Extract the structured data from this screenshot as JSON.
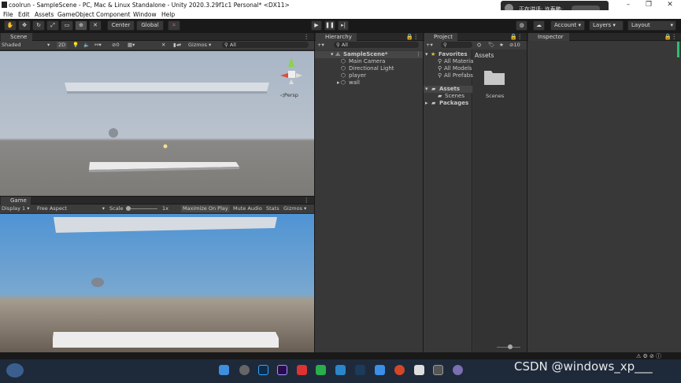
{
  "window": {
    "title": "coolrun - SampleScene - PC, Mac & Linux Standalone - Unity 2020.3.29f1c1 Personal* <DX11>"
  },
  "notification": {
    "text": "正在讲话: 许寿鹏;"
  },
  "menu": [
    "File",
    "Edit",
    "Assets",
    "GameObject",
    "Component",
    "Window",
    "Help"
  ],
  "toolbar": {
    "center": "Center",
    "global": "Global",
    "account": "Account",
    "layers": "Layers",
    "layout": "Layout"
  },
  "scene": {
    "tab": "Scene",
    "shading": "Shaded",
    "mode2d": "2D",
    "hidden_count": "0",
    "gizmos": "Gizmos",
    "search_placeholder": "All",
    "persp": "Persp"
  },
  "game": {
    "tab": "Game",
    "display": "Display 1",
    "aspect": "Free Aspect",
    "scale_label": "Scale",
    "scale_value": "1x",
    "maximize": "Maximize On Play",
    "mute": "Mute Audio",
    "stats": "Stats",
    "gizmos": "Gizmos"
  },
  "hierarchy": {
    "tab": "Hierarchy",
    "search_placeholder": "All",
    "scene": "SampleScene*",
    "items": [
      "Main Camera",
      "Directional Light",
      "player",
      "wall"
    ]
  },
  "project": {
    "tab": "Project",
    "favorites": "Favorites",
    "fav_items": [
      "All Materials",
      "All Models",
      "All Prefabs"
    ],
    "assets": "Assets",
    "asset_children": [
      "Scenes"
    ],
    "packages": "Packages",
    "breadcrumb": "Assets",
    "folder": "Scenes",
    "count": "10"
  },
  "inspector": {
    "tab": "Inspector"
  },
  "watermark": "CSDN @windows_xp___",
  "colors": {
    "scene_sky": "#a9b6c6",
    "scene_ground": "#7d7b77",
    "game_sky": "#4f93d4",
    "game_ground": "#685d52",
    "panel": "#383838"
  }
}
